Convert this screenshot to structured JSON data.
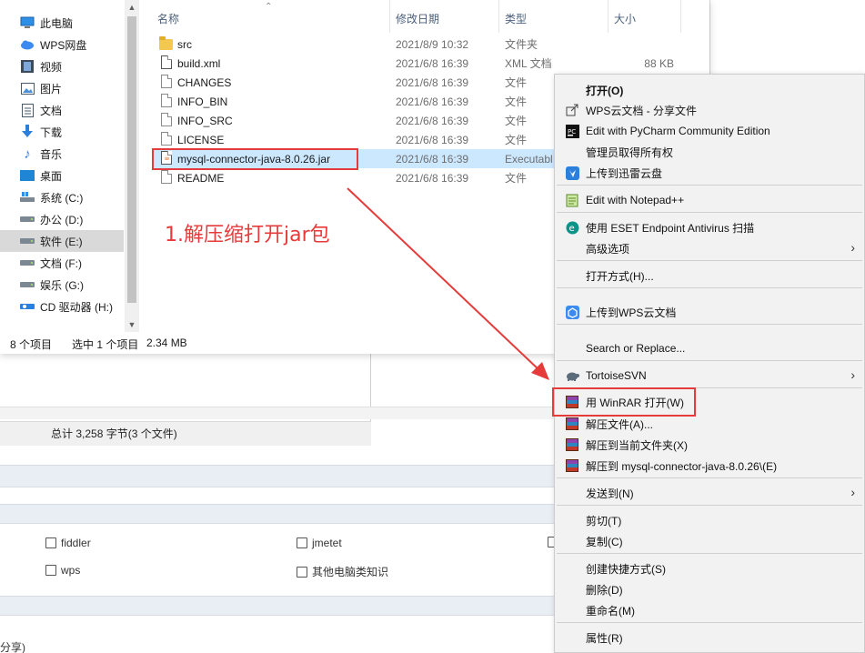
{
  "nav": {
    "items": [
      {
        "label": "此电脑",
        "icon": "computer-icon"
      },
      {
        "label": "WPS网盘",
        "icon": "cloud-icon"
      },
      {
        "label": "视频",
        "icon": "video-icon"
      },
      {
        "label": "图片",
        "icon": "image-icon"
      },
      {
        "label": "文档",
        "icon": "document-icon"
      },
      {
        "label": "下载",
        "icon": "download-icon"
      },
      {
        "label": "音乐",
        "icon": "music-icon"
      },
      {
        "label": "桌面",
        "icon": "desktop-icon"
      },
      {
        "label": "系统 (C:)",
        "icon": "windows-drive-icon"
      },
      {
        "label": "办公 (D:)",
        "icon": "drive-icon"
      },
      {
        "label": "软件 (E:)",
        "icon": "drive-icon"
      },
      {
        "label": "文档 (F:)",
        "icon": "drive-icon"
      },
      {
        "label": "娱乐 (G:)",
        "icon": "drive-icon"
      },
      {
        "label": "CD 驱动器 (H:)",
        "icon": "cd-drive-icon"
      }
    ]
  },
  "columns": {
    "name": "名称",
    "date": "修改日期",
    "type": "类型",
    "size": "大小"
  },
  "files": [
    {
      "name": "src",
      "date": "2021/8/9 10:32",
      "type": "文件夹",
      "size": ""
    },
    {
      "name": "build.xml",
      "date": "2021/6/8 16:39",
      "type": "XML 文档",
      "size": "88 KB"
    },
    {
      "name": "CHANGES",
      "date": "2021/6/8 16:39",
      "type": "文件",
      "size": ""
    },
    {
      "name": "INFO_BIN",
      "date": "2021/6/8 16:39",
      "type": "文件",
      "size": ""
    },
    {
      "name": "INFO_SRC",
      "date": "2021/6/8 16:39",
      "type": "文件",
      "size": ""
    },
    {
      "name": "LICENSE",
      "date": "2021/6/8 16:39",
      "type": "文件",
      "size": ""
    },
    {
      "name": "mysql-connector-java-8.0.26.jar",
      "date": "2021/6/8 16:39",
      "type": "Executabl",
      "size": ""
    },
    {
      "name": "README",
      "date": "2021/6/8 16:39",
      "type": "文件",
      "size": ""
    }
  ],
  "status": {
    "count": "8 个项目",
    "selected": "选中 1 个项目",
    "size": "2.34 MB"
  },
  "secondary_status": "总计 3,258 字节(3 个文件)",
  "annotation": "1.解压缩打开jar包",
  "background": {
    "checkboxes": [
      "fiddler",
      "jmetet",
      "wps",
      "其他电脑类知识"
    ],
    "bottom_fragment": "分享)"
  },
  "context_menu": {
    "items": [
      {
        "label": "打开(O)",
        "bold": true
      },
      {
        "label": "WPS云文档 - 分享文件",
        "icon": "share-icon"
      },
      {
        "label": "Edit with PyCharm Community Edition",
        "icon": "pycharm-icon"
      },
      {
        "label": "管理员取得所有权"
      },
      {
        "label": "上传到迅雷云盘",
        "icon": "thunder-icon"
      },
      {
        "label": "Edit with Notepad++",
        "icon": "notepad-icon"
      },
      {
        "label": "使用 ESET Endpoint Antivirus 扫描",
        "icon": "eset-icon"
      },
      {
        "label": "高级选项",
        "submenu": true
      },
      {
        "label": "打开方式(H)..."
      },
      {
        "label": "上传到WPS云文档",
        "icon": "wps-cloud-icon"
      },
      {
        "label": "Search or Replace..."
      },
      {
        "label": "TortoiseSVN",
        "icon": "tortoise-svn-icon",
        "submenu": true
      },
      {
        "label": "用 WinRAR 打开(W)",
        "icon": "winrar-icon"
      },
      {
        "label": "解压文件(A)...",
        "icon": "winrar-icon"
      },
      {
        "label": "解压到当前文件夹(X)",
        "icon": "winrar-icon"
      },
      {
        "label": "解压到 mysql-connector-java-8.0.26\\(E)",
        "icon": "winrar-icon"
      },
      {
        "label": "发送到(N)",
        "submenu": true
      },
      {
        "label": "剪切(T)"
      },
      {
        "label": "复制(C)"
      },
      {
        "label": "创建快捷方式(S)"
      },
      {
        "label": "删除(D)"
      },
      {
        "label": "重命名(M)"
      },
      {
        "label": "属性(R)"
      }
    ],
    "submenu_arrow": "›"
  },
  "colors": {
    "accent_red": "#e53b3b",
    "selection": "#cce8ff"
  }
}
